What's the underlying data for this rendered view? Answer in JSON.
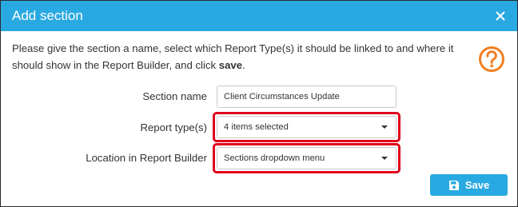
{
  "dialog": {
    "title": "Add section",
    "close_icon": "close-icon",
    "instructions": {
      "text_before": "Please give the section a name, select which Report Type(s) it should be linked to and where it should show in the Report Builder, and click ",
      "bold_word": "save",
      "text_after": "."
    },
    "help_icon": "question-circle-icon",
    "form": {
      "section_name": {
        "label": "Section name",
        "value": "Client Circumstances Update"
      },
      "report_types": {
        "label": "Report type(s)",
        "selected": "4 items selected"
      },
      "location": {
        "label": "Location in Report Builder",
        "selected": "Sections dropdown menu"
      }
    },
    "save_button": {
      "label": "Save",
      "icon": "floppy-disk-icon"
    }
  },
  "colors": {
    "header": "#29a9e1",
    "save_button": "#29a9e1",
    "help_icon": "#f07f22",
    "highlight": "#e0001b"
  }
}
